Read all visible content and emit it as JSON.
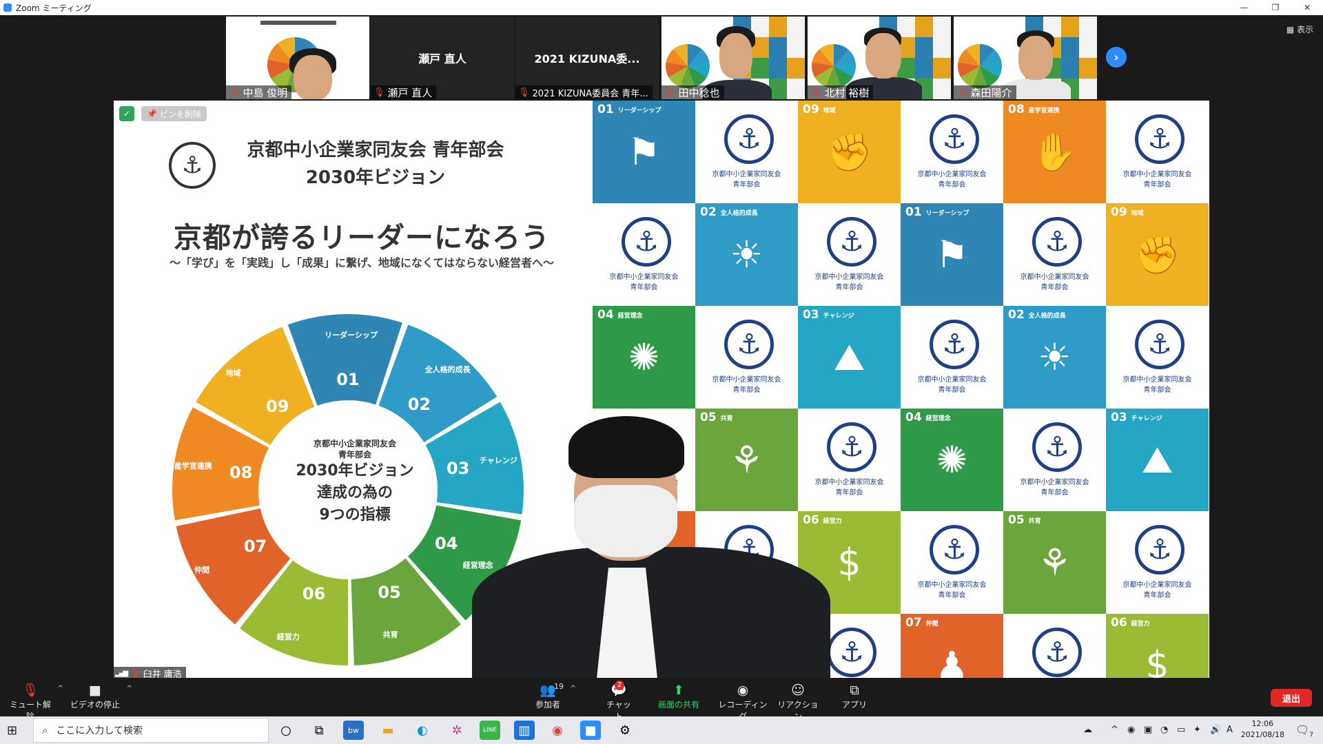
{
  "window": {
    "title": "Zoom ミーティング",
    "controls": [
      "—",
      "❐",
      "✕"
    ]
  },
  "filmstrip": [
    {
      "name": "中島 俊明",
      "type": "video-slide"
    },
    {
      "name": "瀬戸 直人",
      "center": "瀬戸 直人",
      "type": "text"
    },
    {
      "name": "2021 KIZUNA委員会 青年...",
      "center": "2021 KIZUNA委...",
      "type": "text"
    },
    {
      "name": "田中稔也",
      "type": "video-mosaic"
    },
    {
      "name": "北村 裕樹",
      "type": "video-mosaic"
    },
    {
      "name": "森田陽介",
      "type": "video-mosaic"
    }
  ],
  "view_label": "表示",
  "share": {
    "unpin_label": "ピンを削除",
    "org_title_line1": "京都中小企業家同友会 青年部会",
    "org_title_line2": "2030年ビジョン",
    "main_title": "京都が誇るリーダーになろう",
    "subtitle": "〜「学び」を「実践」し「成果」に繋げ、地域になくてはならない経営者へ〜",
    "wheel_center": {
      "org1": "京都中小企業家同友会",
      "org2": "青年部会",
      "line1": "2030年ビジョン",
      "line2": "達成の為の",
      "line3": "9つの指標"
    },
    "wheel_segments": [
      {
        "num": "01",
        "label": "リーダーシップ",
        "color": "#2f86b4"
      },
      {
        "num": "02",
        "label": "全人格的成長",
        "color": "#2f9cc8"
      },
      {
        "num": "03",
        "label": "チャレンジ",
        "color": "#24a6c4"
      },
      {
        "num": "04",
        "label": "経営理念",
        "color": "#2f9a47"
      },
      {
        "num": "05",
        "label": "共育",
        "color": "#6aa63b"
      },
      {
        "num": "06",
        "label": "経営力",
        "color": "#9bbb35"
      },
      {
        "num": "07",
        "label": "仲間",
        "color": "#e2632a"
      },
      {
        "num": "08",
        "label": "産学官連携",
        "color": "#ef8a23"
      },
      {
        "num": "09",
        "label": "地域",
        "color": "#efb022"
      }
    ],
    "logo_text_line1": "京都中小企業家同友会",
    "logo_text_line2": "青年部会",
    "presenter_name": "臼井 庸浩"
  },
  "toolbar": {
    "mute": "ミュート解除",
    "video": "ビデオの停止",
    "participants": "参加者",
    "participants_count": "19",
    "chat": "チャット",
    "chat_badge": "2",
    "share": "画面の共有",
    "record": "レコーディング",
    "reaction": "リアクション",
    "apps": "アプリ",
    "leave": "退出"
  },
  "taskbar": {
    "search_placeholder": "ここに入力して検索",
    "time": "12:06",
    "date": "2021/08/18",
    "ime": "A",
    "notif_count": "7"
  }
}
